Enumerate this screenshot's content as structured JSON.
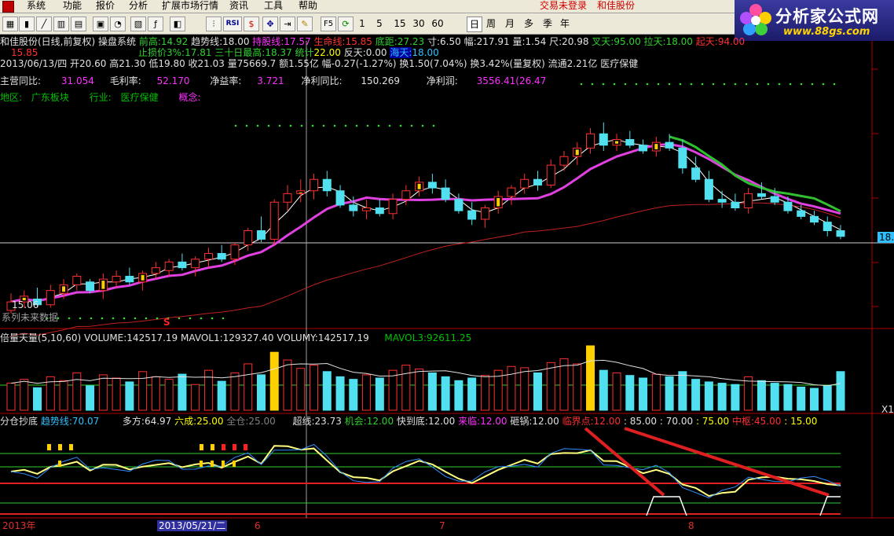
{
  "menu": {
    "items": [
      "系统",
      "功能",
      "报价",
      "分析",
      "扩展市场行情",
      "资讯",
      "工具",
      "帮助"
    ],
    "trade_status": "交易未登录",
    "stock_name": "和佳股份"
  },
  "toolbar": {
    "buttons": [
      "F5",
      "1",
      "5",
      "15",
      "30",
      "60",
      "日",
      "周",
      "月",
      "多",
      "季",
      "年"
    ]
  },
  "logo": {
    "title": "分析家公式网",
    "url": "www.88gs.com"
  },
  "main_panel": {
    "line1": {
      "title": "和佳股份(日线,前复权) 操盘系统",
      "qian_gao_label": "前高:",
      "qian_gao": "14.92",
      "trend_label": "趋势线:",
      "trend": "18.00",
      "hold_label": "持股线:",
      "hold": "17.57",
      "life_label": "生命线:",
      "life": "15.85",
      "bottom_label": "底距:",
      "bottom": "27.23",
      "cun_label": "寸:",
      "cun": "6.50",
      "fu_label": "幅:",
      "fu": "217.91",
      "liang_label": "量:",
      "liang": "1.54",
      "chi_label": "尺:",
      "chi": "20.98",
      "chatian_label": "叉天:",
      "chatian": "95.00",
      "latian_label": "拉天:",
      "latian": "18.00",
      "qitian_label": "起天:",
      "qitian": "94.00"
    },
    "line2": {
      "val": "15.85",
      "stop_label": "止损价3%:",
      "stop": "17.81",
      "high30_label": "三十日最高:",
      "high30": "18.37",
      "stat_label": "统计",
      "stat": "22.00",
      "fantian_label": "反天:",
      "fantian": "0.00",
      "haitian_label": "海天:",
      "haitian": "18.00"
    },
    "line3": "2013/06/13/四 开20.60 高21.30 低19.80 收21.03 量75669.7 额1.55亿 幅-0.27(-1.27%) 换1.50(7.04%) 换3.42%(量复权) 流通2.21亿 医疗保健",
    "line4": {
      "zy_label": "主营同比:",
      "zy": "31.054",
      "mll_label": "毛利率:",
      "mll": "52.170",
      "jyl_label": "净益率:",
      "jyl": "3.721",
      "jltb_label": "净利同比:",
      "jltb": "150.269",
      "jlr_label": "净利润:",
      "jlr": "3556.41(26.47"
    },
    "line5": {
      "region_label": "地区:",
      "region": "广东板块",
      "industry_label": "行业:",
      "industry": "医疗保健",
      "concept_label": "概念:"
    },
    "price_low_label": "15.06",
    "future_note": "系列未来数据",
    "right_price": "18.",
    "signal_s": "S"
  },
  "volume_panel": {
    "title": "倍量天量(5,10,60)",
    "volume_label": "VOLUME:",
    "volume": "142517.19",
    "mavol1_label": "MAVOL1:",
    "mavol1": "129327.40",
    "volumy_label": "VOLUMY:",
    "volumy": "142517.19",
    "mavol3_label": "MAVOL3:",
    "mavol3": "92611.25",
    "right_label": "X1"
  },
  "indicator_panel": {
    "title": "分仓抄底",
    "trend_label": "趋势线:",
    "trend": "70.07",
    "duofang_label": "多方:",
    "duofang": "64.97",
    "liucheng_label": "六成:",
    "liucheng": "25.00",
    "quancang_label": "全仓:",
    "quancang": "25.00",
    "chaoxian_label": "超线:",
    "chaoxian": "23.73",
    "jihui_label": "机会:",
    "jihui": "12.00",
    "kuaidaodi_label": "快到底:",
    "kuaidaodi": "12.00",
    "lailin_label": "来临:",
    "lailin": "12.00",
    "zaguo_label": "砸锅:",
    "zaguo": "12.00",
    "linjie_label": "临界点:",
    "linjie": "12.00",
    "v85": ": 85.00",
    "v70": ": 70.00",
    "v75": ": 75.00",
    "zhongshu_label": "中枢:",
    "zhongshu": "45.00",
    "v15": ": 15.00"
  },
  "time_axis": {
    "year": "2013年",
    "cursor_date": "2013/05/21/二",
    "m6": "6",
    "m7": "7",
    "m8": "8"
  },
  "colors": {
    "bg": "#000000",
    "up": "#ff3030",
    "down": "#50e0f0",
    "ma_magenta": "#e040e0",
    "ma_green": "#30c030",
    "ma_white": "#ffffff",
    "ma_red": "#c02020",
    "signal_yellow": "#ffd000"
  },
  "chart_data": {
    "type": "candlestick",
    "dates_note": "daily, 2013 (year label shown)",
    "ylim": [
      15,
      23
    ],
    "candles": [
      [
        15.0,
        15.6,
        14.9,
        15.3
      ],
      [
        15.3,
        15.7,
        15.1,
        15.5
      ],
      [
        15.4,
        15.8,
        15.1,
        15.2
      ],
      [
        15.2,
        15.9,
        15.1,
        15.7
      ],
      [
        15.6,
        16.1,
        15.4,
        15.9
      ],
      [
        15.9,
        16.3,
        15.7,
        16.2
      ],
      [
        16.0,
        16.1,
        15.6,
        15.7
      ],
      [
        15.7,
        16.3,
        15.4,
        16.1
      ],
      [
        16.0,
        16.4,
        15.8,
        16.2
      ],
      [
        16.2,
        16.5,
        15.9,
        16.0
      ],
      [
        16.0,
        16.4,
        15.7,
        16.3
      ],
      [
        16.3,
        16.7,
        16.1,
        16.5
      ],
      [
        16.4,
        16.8,
        16.2,
        16.7
      ],
      [
        16.7,
        17.0,
        16.4,
        16.5
      ],
      [
        16.5,
        16.9,
        16.2,
        16.8
      ],
      [
        16.8,
        17.2,
        16.5,
        17.0
      ],
      [
        17.0,
        17.3,
        16.7,
        16.8
      ],
      [
        16.8,
        17.4,
        16.6,
        17.3
      ],
      [
        17.3,
        17.9,
        17.1,
        17.8
      ],
      [
        17.8,
        18.3,
        17.4,
        17.5
      ],
      [
        17.5,
        18.9,
        17.3,
        18.8
      ],
      [
        18.8,
        19.4,
        18.5,
        19.1
      ],
      [
        19.1,
        19.6,
        18.8,
        19.2
      ],
      [
        19.2,
        19.8,
        18.9,
        19.6
      ],
      [
        19.6,
        19.9,
        19.0,
        19.2
      ],
      [
        19.2,
        19.4,
        18.6,
        18.7
      ],
      [
        18.7,
        19.0,
        18.3,
        18.5
      ],
      [
        18.5,
        18.9,
        18.2,
        18.6
      ],
      [
        18.6,
        18.9,
        18.3,
        18.4
      ],
      [
        18.4,
        19.1,
        18.2,
        18.9
      ],
      [
        18.9,
        19.4,
        18.7,
        19.2
      ],
      [
        19.2,
        19.7,
        19.0,
        19.5
      ],
      [
        19.5,
        19.8,
        19.1,
        19.3
      ],
      [
        19.3,
        19.6,
        18.8,
        18.9
      ],
      [
        18.9,
        19.1,
        18.4,
        18.5
      ],
      [
        18.5,
        18.8,
        18.0,
        18.2
      ],
      [
        18.2,
        18.7,
        17.9,
        18.6
      ],
      [
        18.6,
        19.2,
        18.4,
        19.0
      ],
      [
        19.0,
        19.4,
        18.7,
        19.3
      ],
      [
        19.3,
        19.8,
        19.1,
        19.6
      ],
      [
        19.6,
        19.9,
        19.2,
        19.4
      ],
      [
        19.4,
        20.3,
        19.3,
        20.1
      ],
      [
        20.1,
        20.6,
        19.9,
        20.4
      ],
      [
        20.4,
        20.9,
        20.1,
        20.7
      ],
      [
        20.7,
        21.4,
        20.5,
        21.2
      ],
      [
        21.2,
        21.6,
        20.6,
        20.8
      ],
      [
        20.8,
        21.2,
        20.6,
        21.0
      ],
      [
        21.0,
        21.3,
        20.7,
        20.8
      ],
      [
        20.8,
        21.0,
        20.5,
        20.6
      ],
      [
        20.6,
        21.1,
        20.4,
        20.9
      ],
      [
        20.9,
        21.2,
        20.6,
        20.7
      ],
      [
        20.7,
        21.0,
        19.8,
        20.0
      ],
      [
        20.0,
        20.4,
        19.5,
        19.6
      ],
      [
        19.6,
        19.9,
        18.8,
        18.9
      ],
      [
        18.9,
        19.2,
        18.6,
        18.8
      ],
      [
        18.8,
        19.1,
        18.5,
        18.6
      ],
      [
        18.6,
        19.3,
        18.4,
        19.1
      ],
      [
        19.1,
        19.5,
        18.9,
        19.0
      ],
      [
        19.0,
        19.3,
        18.7,
        18.8
      ],
      [
        18.8,
        19.0,
        18.4,
        18.5
      ],
      [
        18.5,
        18.7,
        18.2,
        18.3
      ],
      [
        18.3,
        18.5,
        18.0,
        18.1
      ],
      [
        18.1,
        18.3,
        17.6,
        17.8
      ],
      [
        17.8,
        18.0,
        17.5,
        17.6
      ]
    ],
    "volume_values": [
      42,
      48,
      35,
      52,
      46,
      58,
      38,
      55,
      50,
      44,
      60,
      52,
      48,
      56,
      40,
      62,
      45,
      58,
      72,
      55,
      90,
      78,
      65,
      70,
      60,
      52,
      48,
      55,
      50,
      62,
      70,
      64,
      58,
      52,
      46,
      50,
      54,
      62,
      68,
      66,
      58,
      74,
      80,
      72,
      100,
      62,
      58,
      54,
      50,
      56,
      52,
      60,
      48,
      44,
      42,
      40,
      52,
      46,
      42,
      40,
      36,
      34,
      38,
      60
    ]
  }
}
